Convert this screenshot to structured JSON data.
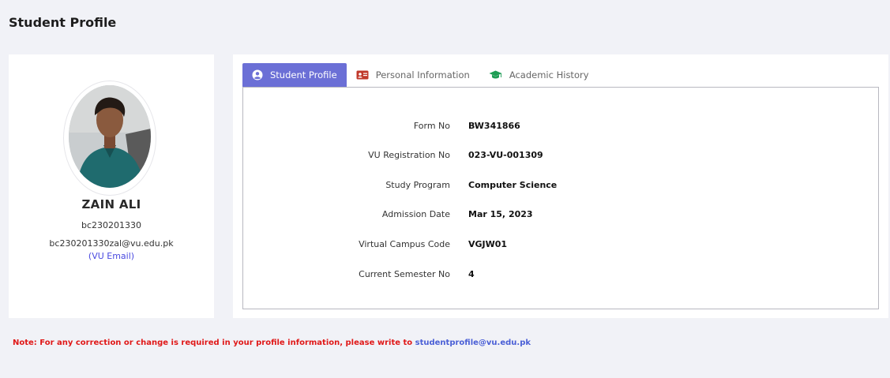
{
  "page": {
    "title": "Student Profile"
  },
  "profile": {
    "name": "ZAIN ALI",
    "id": "bc230201330",
    "email": "bc230201330zal@vu.edu.pk",
    "email_label": "(VU Email)"
  },
  "tabs": [
    {
      "label": "Student Profile",
      "icon": "user-circle-icon",
      "active": true
    },
    {
      "label": "Personal Information",
      "icon": "id-card-icon",
      "active": false
    },
    {
      "label": "Academic History",
      "icon": "graduation-cap-icon",
      "active": false
    }
  ],
  "fields": [
    {
      "label": "Form No",
      "value": "BW341866"
    },
    {
      "label": "VU Registration No",
      "value": "023-VU-001309"
    },
    {
      "label": "Study Program",
      "value": "Computer Science"
    },
    {
      "label": "Admission Date",
      "value": "Mar 15, 2023"
    },
    {
      "label": "Virtual Campus Code",
      "value": "VGJW01"
    },
    {
      "label": "Current Semester No",
      "value": "4"
    }
  ],
  "note": {
    "text": "Note: For any correction or change is required in your profile information, please write to",
    "email": "studentprofile@vu.edu.pk"
  },
  "colors": {
    "active_tab": "#6b6fd6",
    "note_text": "#e01818",
    "link": "#4a5fd6",
    "id_card_icon": "#c0392b",
    "graduation_icon": "#1f9d55"
  }
}
